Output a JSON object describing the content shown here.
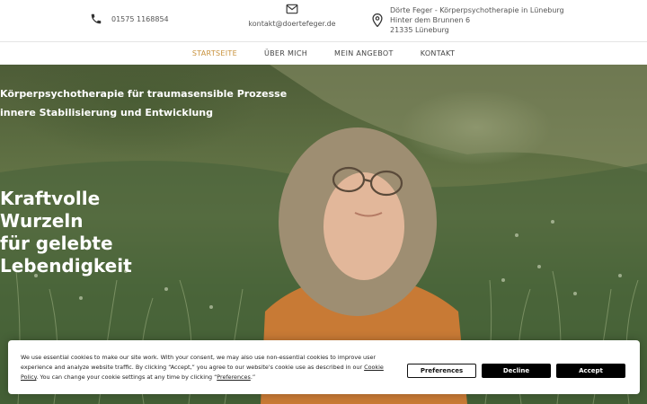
{
  "header": {
    "phone": "01575 1168854",
    "email": "kontakt@doertefeger.de",
    "address": {
      "line1": "Dörte Feger - Körperpsychotherapie in Lüneburg",
      "line2": "Hinter dem Brunnen 6",
      "line3": "21335 Lüneburg"
    },
    "icons": {
      "phone": "phone-icon",
      "email": "mail-icon",
      "address": "map-pin-icon"
    }
  },
  "nav": {
    "items": [
      {
        "label": "STARTSEITE",
        "active": true
      },
      {
        "label": "ÜBER MICH",
        "active": false
      },
      {
        "label": "MEIN ANGEBOT",
        "active": false
      },
      {
        "label": "KONTAKT",
        "active": false
      }
    ],
    "active_color": "#c8913b"
  },
  "hero": {
    "tagline1": "Körperpsychotherapie für traumasensible Prozesse",
    "tagline2": "innere Stabilisierung und Entwicklung",
    "headline": [
      "Kraftvolle",
      "Wurzeln",
      "für gelebte",
      "Lebendigkeit"
    ]
  },
  "cookie": {
    "text_part1": "We use essential cookies to make our site work. With your consent, we may also use non-essential cookies to improve user experience and analyze website traffic. By clicking “Accept,” you agree to our website's cookie use as described in our ",
    "policy_link": "Cookie Policy",
    "text_part2": ". You can change your cookie settings at any time by clicking “",
    "preferences_link": "Preferences",
    "text_part3": ".”",
    "buttons": {
      "preferences": "Preferences",
      "decline": "Decline",
      "accept": "Accept"
    }
  }
}
